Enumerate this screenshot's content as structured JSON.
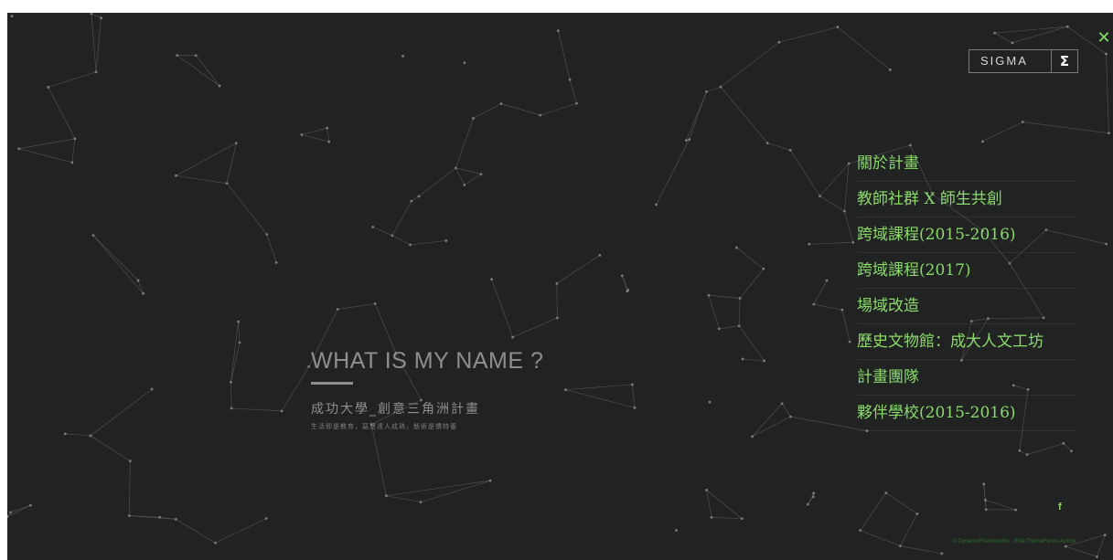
{
  "close": {
    "glyph": "✕"
  },
  "logo": {
    "text": "SIGMA",
    "symbol": "Σ"
  },
  "hero": {
    "title": "WHAT IS MY NAME ?",
    "subtitle": "成功大學_創意三角洲計畫",
    "tagline": "生活即是教育，惡慧達人成熟，態術是慣特養"
  },
  "menu": {
    "items": [
      {
        "label": "關於計畫"
      },
      {
        "label": "教師社群 X 師生共創"
      },
      {
        "label": "跨域課程(2015-2016)"
      },
      {
        "label": "跨域課程(2017)"
      },
      {
        "label": "場域改造"
      },
      {
        "label": "歷史文物館：成大人文工坊"
      },
      {
        "label": "計畫團隊"
      },
      {
        "label": "夥伴學校(2015-2016)"
      }
    ]
  },
  "social": {
    "facebook": "f"
  },
  "footer": {
    "copyright": "© DynamicFrameworks · Elite ThemeForest Author"
  },
  "theme": {
    "accent": "#8bd96b",
    "background": "#212323",
    "text": "#8e8e8e",
    "line": "#5a5c5c"
  }
}
